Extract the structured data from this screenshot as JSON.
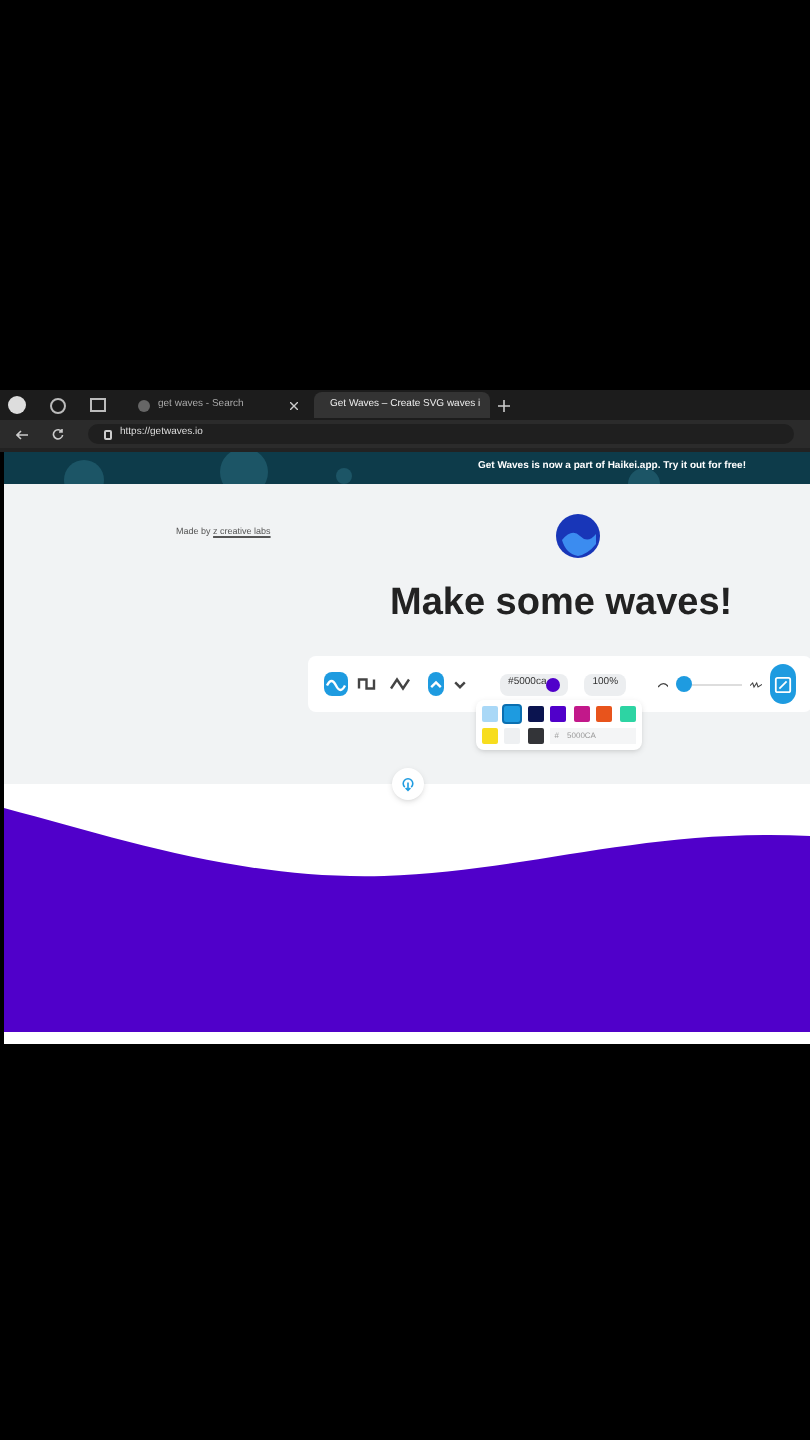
{
  "browser": {
    "tabs": [
      {
        "title": "get waves - Search",
        "selected": false
      },
      {
        "title": "Get Waves – Create SVG waves i",
        "selected": true
      }
    ],
    "url": "https://getwaves.io"
  },
  "banner": {
    "text": "Get Waves is now a part of **Haikei.app**. Try it out for free!"
  },
  "credit": {
    "prefix": "Made by",
    "link": "z creative labs"
  },
  "heading": "Make some waves!",
  "toolbar": {
    "wave_types": [
      {
        "selected": true
      },
      {
        "selected": false
      },
      {
        "selected": false
      }
    ],
    "direction": {
      "selected": true
    },
    "color": "#5000ca",
    "opacity": "100",
    "percent": "%",
    "complexity": {
      "level": 0.1
    }
  },
  "palette": {
    "swatches": [
      {
        "color": "#a9d8f7",
        "selected": false
      },
      {
        "color": "#1e9be0",
        "selected": true
      },
      {
        "color": "#0b1450",
        "selected": false
      },
      {
        "color": "#5000ca",
        "selected": false
      },
      {
        "color": "#c2188a",
        "selected": false
      },
      {
        "color": "#e8541c",
        "selected": false
      },
      {
        "color": "#2dd4a3",
        "selected": false
      },
      {
        "color": "#f7dd1e",
        "selected": false
      },
      {
        "color": "#eef0f2",
        "selected": false
      },
      {
        "color": "#333438",
        "selected": false
      }
    ],
    "hash": "#",
    "hex": "5000CA"
  }
}
